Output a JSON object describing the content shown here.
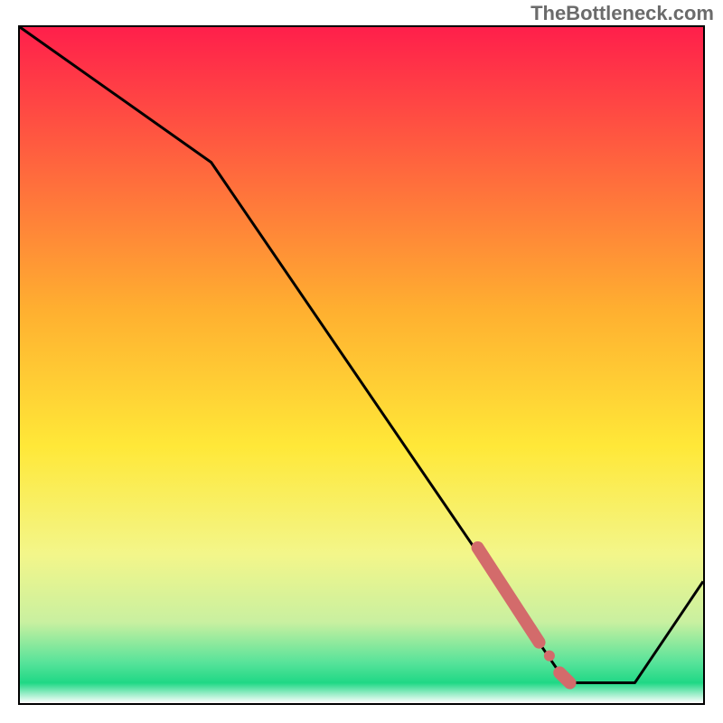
{
  "watermark": "TheBottleneck.com",
  "colors": {
    "line": "#000000",
    "marker": "#d36b6b",
    "border": "#000000"
  },
  "chart_data": {
    "type": "line",
    "title": "",
    "xlabel": "",
    "ylabel": "",
    "xlim": [
      0,
      100
    ],
    "ylim": [
      0,
      100
    ],
    "legend": false,
    "grid": false,
    "background": "gradient-red-yellow-green",
    "series": [
      {
        "name": "bottleneck-curve",
        "x": [
          0,
          28,
          80,
          90,
          100
        ],
        "y": [
          100,
          80,
          3,
          3,
          18
        ]
      }
    ],
    "markers": [
      {
        "name": "highlight-segment",
        "shape": "thick-line",
        "color": "#d36b6b",
        "x": [
          67,
          76
        ],
        "y": [
          23,
          9
        ]
      },
      {
        "name": "highlight-dot-1",
        "shape": "circle",
        "color": "#d36b6b",
        "x": 77.5,
        "y": 7
      },
      {
        "name": "highlight-dots-low",
        "shape": "thick-line",
        "color": "#d36b6b",
        "x": [
          79,
          80.5
        ],
        "y": [
          4.5,
          3
        ]
      }
    ],
    "gradient_stops": [
      {
        "offset": 0,
        "color": "#ff1f4b"
      },
      {
        "offset": 42,
        "color": "#ffb030"
      },
      {
        "offset": 62,
        "color": "#ffe838"
      },
      {
        "offset": 78,
        "color": "#f3f68a"
      },
      {
        "offset": 88,
        "color": "#c9f0a0"
      },
      {
        "offset": 94,
        "color": "#57e39a"
      },
      {
        "offset": 97,
        "color": "#1fd885"
      },
      {
        "offset": 100,
        "color": "#ffffff"
      }
    ]
  }
}
